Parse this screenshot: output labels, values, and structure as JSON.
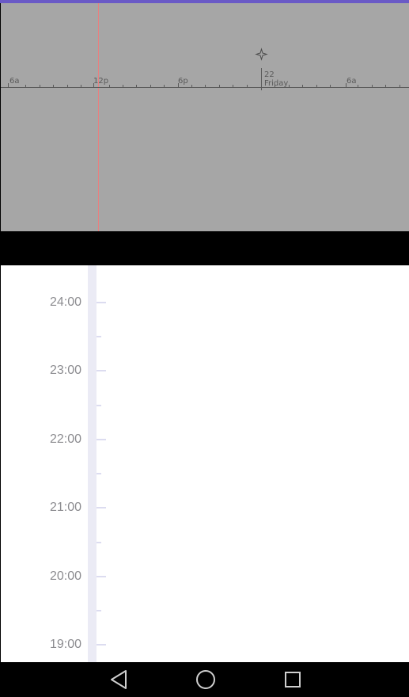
{
  "timeline": {
    "labels": {
      "six_am": "6a",
      "noon": "12p",
      "six_pm": "6p",
      "day_number": "22",
      "day_name": "Friday",
      "six_am_next": "6a"
    },
    "colors": {
      "background": "#a6a6a6",
      "axis": "#5a5a5a",
      "now_line": "#e88080",
      "accent": "#6a5ac6"
    }
  },
  "hour_scale": {
    "hours": [
      "24:00",
      "23:00",
      "22:00",
      "21:00",
      "20:00",
      "19:00"
    ],
    "colors": {
      "rail": "#ebebf5",
      "tick": "#dcdcf0",
      "label": "#8c8c90"
    }
  },
  "navbar": {
    "back_icon": "back-triangle-icon",
    "home_icon": "home-circle-icon",
    "recents_icon": "recents-square-icon"
  }
}
